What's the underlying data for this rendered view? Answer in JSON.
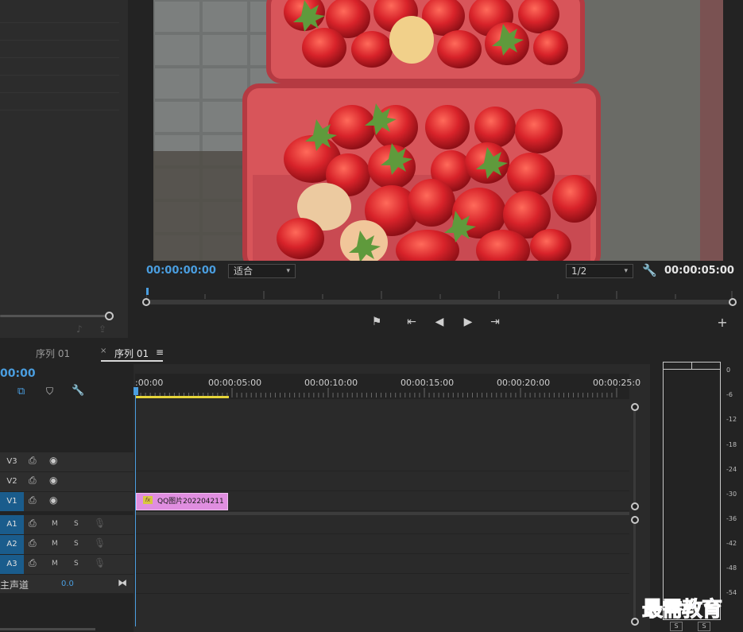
{
  "monitor": {
    "current_timecode": "00:00:00:00",
    "zoom_value": "适合",
    "resolution_value": "1/2",
    "duration_timecode": "00:00:05:00"
  },
  "timeline": {
    "tabs": [
      {
        "label": "序列 01"
      },
      {
        "label": "序列 01"
      }
    ],
    "close_glyph": "×",
    "menu_glyph": "≡",
    "timecode": "00:00",
    "ruler_labels": [
      ":00:00",
      "00:00:05:00",
      "00:00:10:00",
      "00:00:15:00",
      "00:00:20:00",
      "00:00:25:0"
    ],
    "video_tracks": [
      {
        "label": "V3"
      },
      {
        "label": "V2"
      },
      {
        "label": "V1"
      }
    ],
    "audio_tracks": [
      {
        "label": "A1",
        "m": "M",
        "s": "S"
      },
      {
        "label": "A2",
        "m": "M",
        "s": "S"
      },
      {
        "label": "A3",
        "m": "M",
        "s": "S"
      }
    ],
    "master": {
      "label": "主声道",
      "value": "0.0"
    },
    "clip": {
      "fx": "fx",
      "name": "QQ图片202204211"
    }
  },
  "meter": {
    "db_labels": [
      "0",
      "-6",
      "-12",
      "-18",
      "-24",
      "-30",
      "-36",
      "-42",
      "-48",
      "-54"
    ],
    "solo_labels": [
      "S",
      "S"
    ]
  },
  "watermark": "最需教育",
  "colors": {
    "accent_blue": "#4a9ee0",
    "track_blue": "#1a5c8c",
    "clip_pink": "#e08ee0",
    "work_area_yellow": "#e6d53a",
    "watermark_blue": "#1c27d8"
  }
}
